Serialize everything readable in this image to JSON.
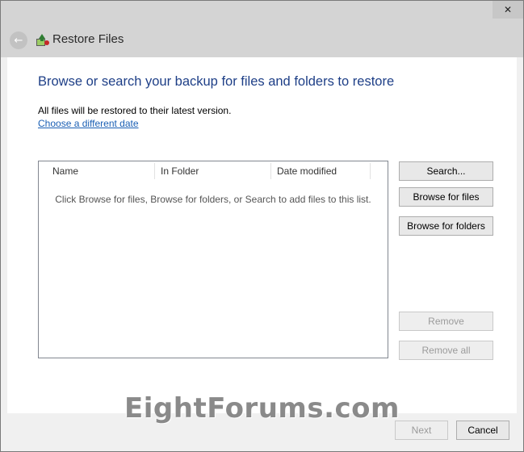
{
  "window": {
    "close_glyph": "✕",
    "back_glyph": "←",
    "app_icon": "restore-files-icon",
    "title": "Restore Files"
  },
  "content": {
    "heading": "Browse or search your backup for files and folders to restore",
    "info_text": "All files will be restored to their latest version.",
    "date_link": "Choose a different date"
  },
  "file_list": {
    "columns": [
      "Name",
      "In Folder",
      "Date modified"
    ],
    "empty_message": "Click Browse for files, Browse for folders, or Search to add files to this list."
  },
  "side_buttons": {
    "search": "Search...",
    "browse_files": "Browse for files",
    "browse_folders": "Browse for folders",
    "remove": "Remove",
    "remove_all": "Remove all"
  },
  "footer": {
    "watermark": "EightForums.com",
    "next": "Next",
    "cancel": "Cancel"
  },
  "colors": {
    "heading": "#1e3f87",
    "link": "#1a5fb4",
    "titlebar": "#d4d4d4"
  }
}
